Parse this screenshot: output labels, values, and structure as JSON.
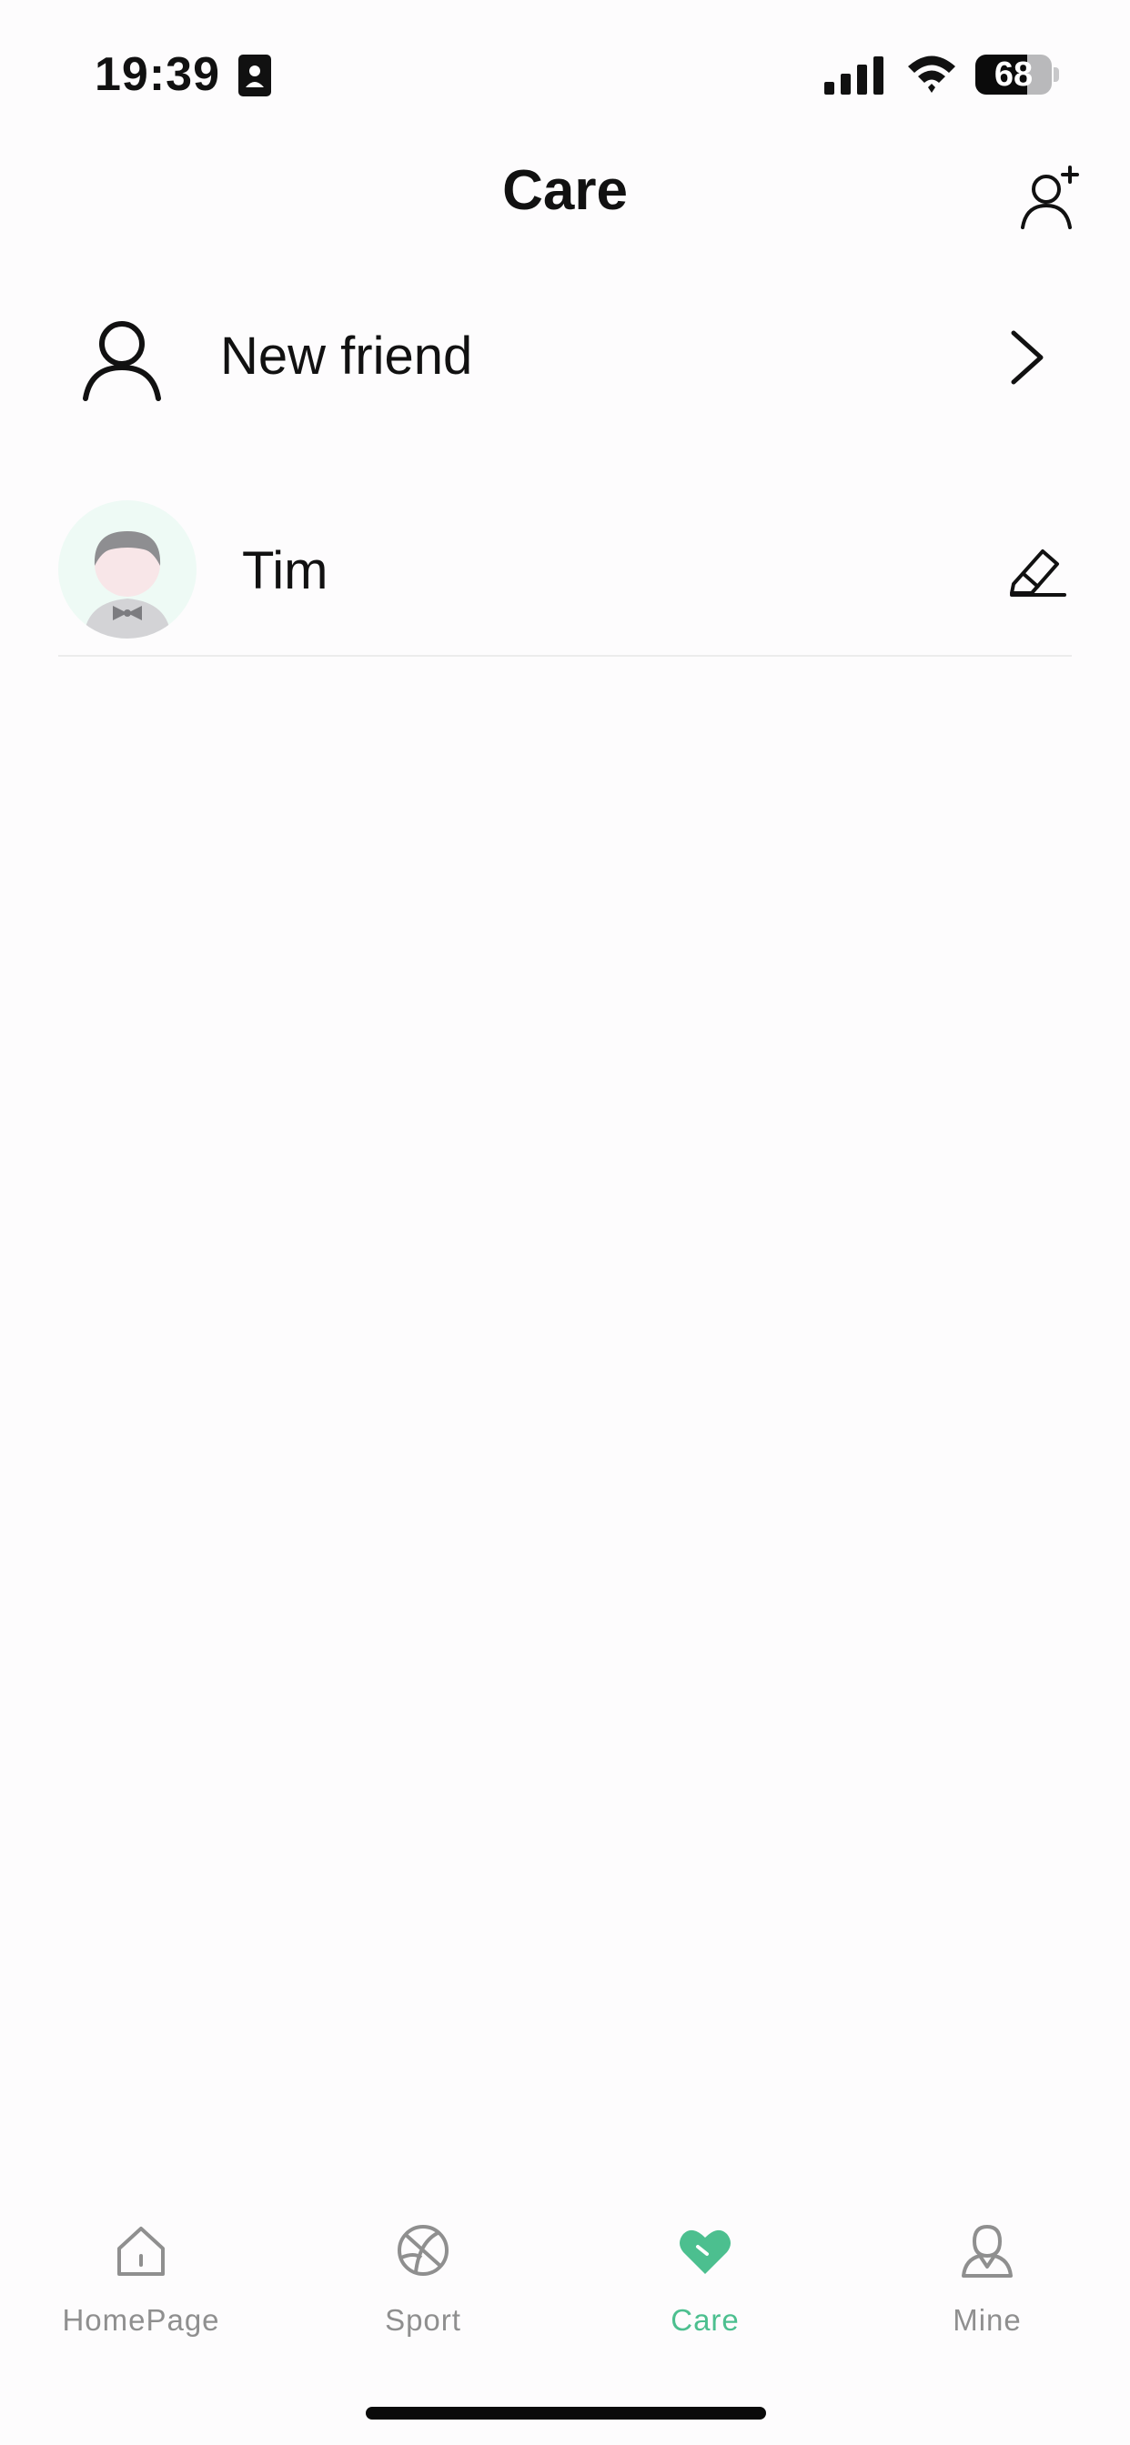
{
  "status_bar": {
    "time": "19:39",
    "battery_level": "68",
    "battery_fraction": 0.68
  },
  "header": {
    "title": "Care"
  },
  "new_friend": {
    "label": "New friend"
  },
  "contacts": [
    {
      "name": "Tim"
    }
  ],
  "tabs": [
    {
      "label": "HomePage",
      "icon": "home-icon",
      "active": false
    },
    {
      "label": "Sport",
      "icon": "ball-icon",
      "active": false
    },
    {
      "label": "Care",
      "icon": "heart-icon",
      "active": true
    },
    {
      "label": "Mine",
      "icon": "person-icon",
      "active": false
    }
  ],
  "colors": {
    "accent": "#4cbf8f",
    "inactive_tab": "#8f8f8f",
    "divider": "#ececec"
  }
}
